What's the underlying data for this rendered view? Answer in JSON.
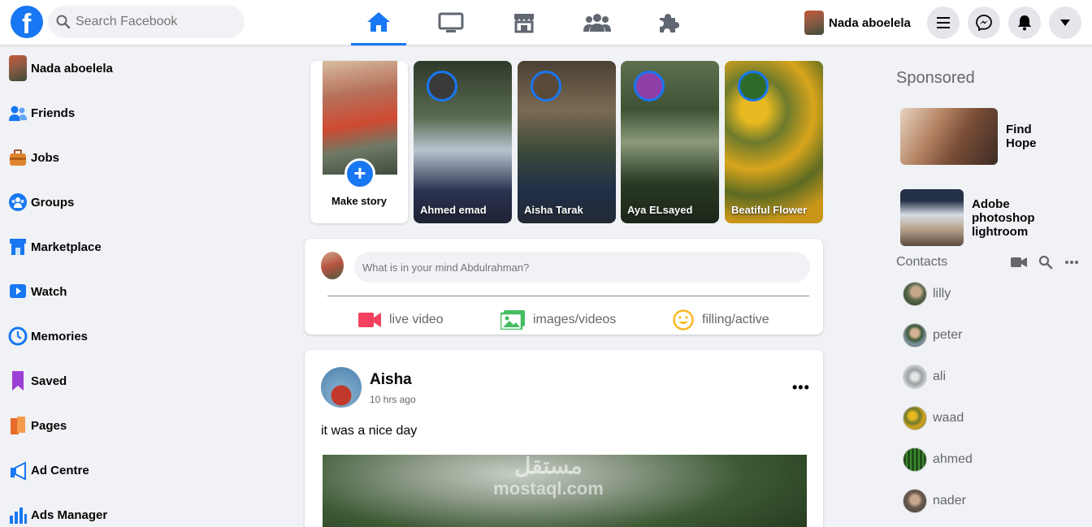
{
  "header": {
    "logo_letter": "f",
    "search_placeholder": "Search Facebook",
    "user_name": "Nada aboelela"
  },
  "nav_tabs": [
    {
      "name": "home",
      "icon": "home-icon",
      "active": true
    },
    {
      "name": "watch",
      "icon": "tv-icon",
      "active": false
    },
    {
      "name": "marketplace",
      "icon": "store-icon",
      "active": false
    },
    {
      "name": "groups",
      "icon": "people-icon",
      "active": false
    },
    {
      "name": "gaming",
      "icon": "puzzle-icon",
      "active": false
    }
  ],
  "sidebar": {
    "items": [
      {
        "label": "Nada aboelela",
        "icon": "avatar"
      },
      {
        "label": "Friends",
        "icon": "friends-icon"
      },
      {
        "label": "Jobs",
        "icon": "briefcase-icon"
      },
      {
        "label": "Groups",
        "icon": "groups-icon"
      },
      {
        "label": "Marketplace",
        "icon": "marketplace-icon"
      },
      {
        "label": "Watch",
        "icon": "watch-icon"
      },
      {
        "label": "Memories",
        "icon": "clock-icon"
      },
      {
        "label": "Saved",
        "icon": "bookmark-icon"
      },
      {
        "label": "Pages",
        "icon": "flag-icon"
      },
      {
        "label": "Ad Centre",
        "icon": "megaphone-icon"
      },
      {
        "label": "Ads Manager",
        "icon": "bar-chart-icon"
      }
    ]
  },
  "stories": {
    "make_story_label": "Make story",
    "items": [
      {
        "name": "Ahmed emad"
      },
      {
        "name": "Aisha Tarak"
      },
      {
        "name": "Aya ELsayed"
      },
      {
        "name": "Beatiful Flower"
      }
    ]
  },
  "composer": {
    "placeholder": "What is in your mind Abdulrahman?",
    "actions": [
      {
        "label": "live video",
        "icon": "video-camera-icon",
        "color": "#f3425f"
      },
      {
        "label": "images/videos",
        "icon": "photo-icon",
        "color": "#45bd62"
      },
      {
        "label": "filling/active",
        "icon": "smiley-icon",
        "color": "#f7b928"
      }
    ]
  },
  "post": {
    "author": "Aisha",
    "time": "10 hrs ago",
    "text": "it was a nice day",
    "more": "•••"
  },
  "watermark": {
    "line1": "مستقل",
    "line2": "mostaql.com"
  },
  "right": {
    "sponsored_title": "Sponsored",
    "ads": [
      {
        "name": "Find Hope"
      },
      {
        "name": "Adobe photoshop lightroom"
      }
    ],
    "contacts_title": "Contacts",
    "contacts": [
      {
        "name": "lilly"
      },
      {
        "name": "peter"
      },
      {
        "name": "ali"
      },
      {
        "name": "waad"
      },
      {
        "name": "ahmed"
      },
      {
        "name": "nader"
      }
    ]
  },
  "colors": {
    "brand": "#1877f2",
    "background": "#f0f2f5",
    "text_secondary": "#65676b"
  }
}
